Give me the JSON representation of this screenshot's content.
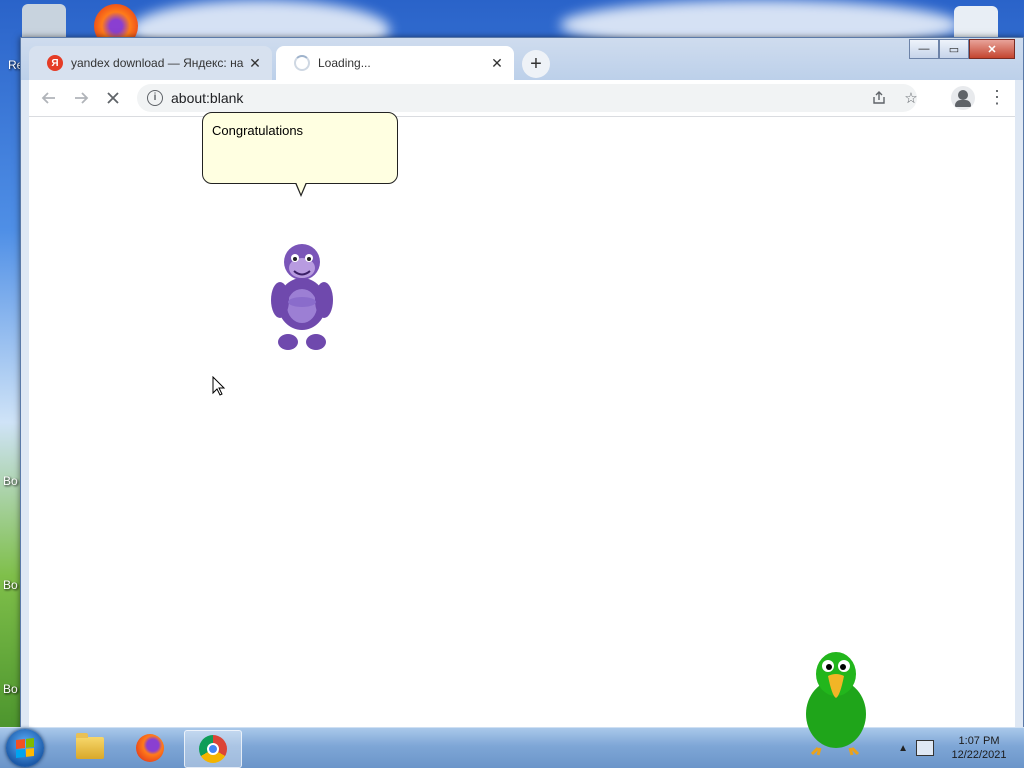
{
  "desktop": {
    "labels": [
      "Re",
      "Bo",
      "Bo",
      "Bo"
    ]
  },
  "browser": {
    "tabs": [
      {
        "title": "yandex download — Яндекс: на",
        "favicon": "Я",
        "state": "inactive"
      },
      {
        "title": "Loading...",
        "favicon": "loading-spinner",
        "state": "active"
      }
    ],
    "new_tab_label": "+",
    "close_tab_label": "✕",
    "address": "about:blank",
    "window_controls": {
      "minimize": "—",
      "maximize": "▭",
      "close": "✕"
    },
    "nav_icons": {
      "back": "arrow-left-icon",
      "forward": "arrow-right-icon",
      "stop": "stop-icon"
    }
  },
  "page": {
    "bubble_text": "Congratulations"
  },
  "taskbar": {
    "apps": [
      "windows-explorer",
      "firefox",
      "chrome"
    ],
    "active_app": "chrome",
    "clock_time": "1:07 PM",
    "clock_date": "12/22/2021"
  },
  "colors": {
    "bubble_bg": "#ffffe1",
    "bonzi_purple": "#7a55b8",
    "parrot_green": "#1fa51a",
    "yandex_red": "#e53c26"
  }
}
